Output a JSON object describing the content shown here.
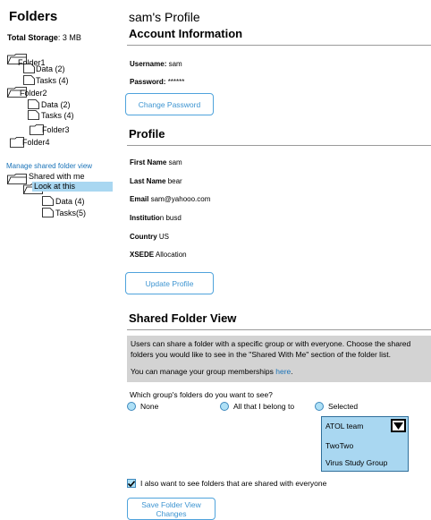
{
  "sidebar": {
    "title": "Folders",
    "storage_label": "Total Storage",
    "storage_value": ": 3 MB",
    "tree": [
      "Folder1",
      "Data (2)",
      "Tasks (4)",
      "Folder2",
      "Data (2)",
      "Tasks (4)",
      "Folder3",
      "Folder4"
    ],
    "manage_link": "Manage shared folder view",
    "shared_tree": [
      "Shared with me",
      "Look at this",
      "Data (4)",
      "Tasks(5)"
    ]
  },
  "main": {
    "title": "sam's Profile",
    "account": {
      "heading": "Account Information",
      "username_label": "Username:",
      "username_value": " sam",
      "password_label": "Password:",
      "password_value": " ******",
      "change_password_button": "Change Password"
    },
    "profile": {
      "heading": "Profile",
      "first_name_label": "First Name",
      "first_name_value": " sam",
      "last_name_label": "Last Name",
      "last_name_value": " bear",
      "email_label": "Email",
      "email_value": " sam@yahooo.com",
      "institution_label": "Institutio",
      "institution_rest": "n busd",
      "country_label": "Country",
      "country_value": " US",
      "xsede_label": "XSEDE",
      "xsede_value": " Allocation",
      "update_button": "Update Profile"
    },
    "shared": {
      "heading": "Shared Folder View",
      "info_line1": "Users can share a folder with a specific group or with everyone.  Choose the shared",
      "info_line2": "folders you would like to see in the \"Shared With Me\" section of the folder list.",
      "info_line3_prefix": "You can manage your group memberships ",
      "info_link": "here",
      "info_line3_suffix": ".",
      "question": "Which group's folders do you want to see?",
      "radio_none": "None",
      "radio_all": "All that I belong to",
      "radio_selected": "Selected",
      "groups": [
        "ATOL team",
        "TwoTwo",
        "Virus Study Group"
      ],
      "checkbox_label": "I also want to see folders that are shared with everyone",
      "checkbox_checked": true,
      "save_button_line1": "Save Folder View",
      "save_button_line2": "Changes"
    }
  }
}
